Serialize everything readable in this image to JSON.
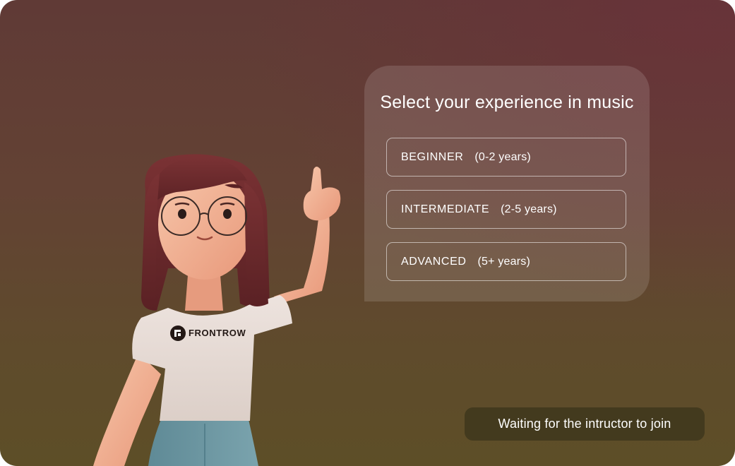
{
  "prompt": {
    "title": "Select your experience in music",
    "options": [
      {
        "level": "BEGINNER",
        "years": "(0-2 years)"
      },
      {
        "level": "INTERMEDIATE",
        "years": "(2-5 years)"
      },
      {
        "level": "ADVANCED",
        "years": "(5+ years)"
      }
    ]
  },
  "mascot": {
    "shirt_text": "FRONTROW"
  },
  "status": {
    "text": "Waiting for the intructor to join"
  },
  "colors": {
    "background_top": "#603a36",
    "background_bottom": "#5d4e27",
    "status_pill": "#433a1e",
    "hair": "#6b2a2c",
    "shirt": "#e9ddd8",
    "skin": "#f2b597",
    "jeans": "#6f98a3"
  }
}
